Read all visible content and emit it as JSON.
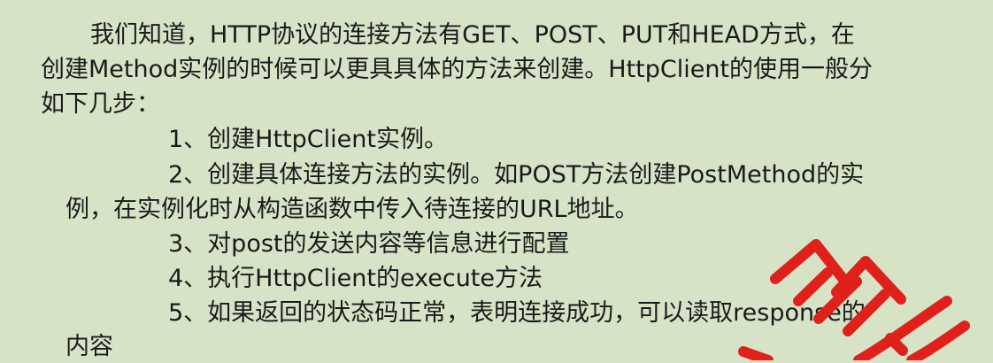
{
  "paragraph": {
    "line1": "我们知道，HTTP协议的连接方法有GET、POST、PUT和HEAD方式，在",
    "line2": "创建Method实例的时候可以更具具体的方法来创建。HttpClient的使用一般分",
    "line3": "如下几步："
  },
  "steps": [
    {
      "text": "1、创建HttpClient实例。"
    },
    {
      "text": "2、创建具体连接方法的实例。如POST方法创建PostMethod的实",
      "continuation": "例，在实例化时从构造函数中传入待连接的URL地址。"
    },
    {
      "text": "3、对post的发送内容等信息进行配置"
    },
    {
      "text": "4、执行HttpClient的execute方法"
    },
    {
      "text": "5、如果返回的状态码正常，表明连接成功，可以读取response的",
      "continuation": "内容"
    }
  ],
  "stamp": {
    "color": "#e0201a",
    "kind": "red-seal-fragment"
  }
}
